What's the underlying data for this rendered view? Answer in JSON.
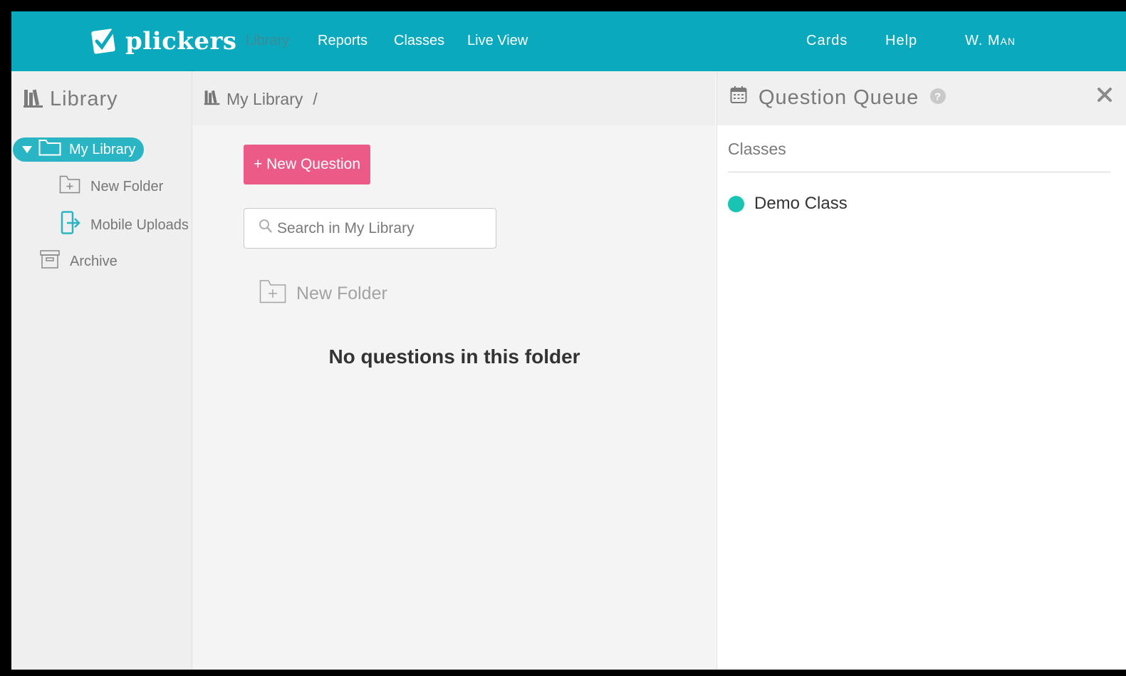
{
  "brand": {
    "name": "plickers"
  },
  "topnav": {
    "items": [
      "Library",
      "Reports",
      "Classes",
      "Live View"
    ],
    "active": "Library",
    "right": [
      "Cards",
      "Help",
      "W. Man"
    ]
  },
  "sidebar": {
    "title": "Library",
    "items": {
      "my_library": "My Library",
      "new_folder": "New Folder",
      "mobile_uploads": "Mobile Uploads",
      "archive": "Archive"
    }
  },
  "main": {
    "breadcrumb": {
      "root": "My Library",
      "separator": "/"
    },
    "new_question_label": "+ New Question",
    "search_placeholder": "Search in My Library",
    "new_folder_label": "New Folder",
    "empty_message": "No questions in this folder"
  },
  "queue": {
    "title": "Question Queue",
    "section_label": "Classes",
    "classes": [
      {
        "name": "Demo Class",
        "color": "#19c4b3"
      }
    ]
  },
  "colors": {
    "topbar": "#0aa9bd",
    "accent": "#2ab5c4",
    "new_question": "#ec5a88",
    "active_nav": "#3f8a95"
  }
}
